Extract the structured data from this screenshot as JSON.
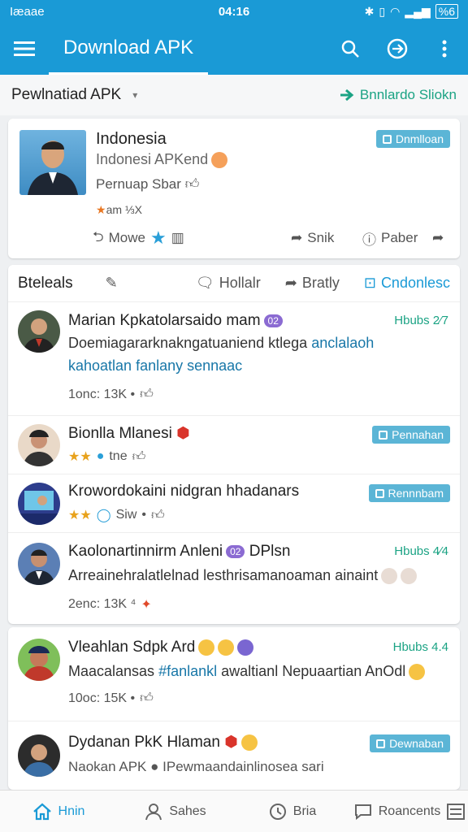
{
  "statusbar": {
    "carrier": "Iæaae",
    "time": "04:16",
    "battery": "%6"
  },
  "appbar": {
    "title": "Download APK"
  },
  "subhead": {
    "title": "Pewlnatiad APK",
    "link": "Bnnlardo Sliokn"
  },
  "card1": {
    "name": "Indonesia",
    "subtitle": "Indonesi APKend",
    "line3": "Pernuap Sbar",
    "line4": "am ⅓X",
    "badge": "Dnmlloan",
    "actions": {
      "more": "Mowe",
      "share": "Snik",
      "paber": "Paber"
    }
  },
  "card2": {
    "head": {
      "title": "Bteleals",
      "comment": "Hollalr",
      "reply": "Bratly",
      "download": "Cndonlesc"
    },
    "posts": [
      {
        "name": "Marian Kpkatolarsaido mam",
        "date": "Hbubs 2⁄7",
        "text1": "Doemiagararknakngatuaniend ktlega",
        "text1b": "anclalaoh",
        "text2": "kahoatlan fanlany sennaac",
        "meta": "1onc:  13K •"
      },
      {
        "name": "Bionlla Mlanesi",
        "badge": "Pennahan",
        "meta": "tne"
      },
      {
        "name": "Krowordokaini nidgran hhadanars",
        "badge": "Rennnbam",
        "meta": "Siw"
      },
      {
        "name": "Kaolonartinnirm Anleni",
        "tag": "DPlsn",
        "date": "Hbubs 4⁄4",
        "text1": "Arreainehralatlelnad lesthrisamanoaman ainaint",
        "meta": "2enc:  13K ⁴"
      }
    ]
  },
  "card3": {
    "posts": [
      {
        "name": "Vleahlan Sdpk Ard",
        "date": "Hbubs 4.4",
        "text1a": "Maacalansas",
        "text1b": "#fanlankl",
        "text1c": "awaltianl Nepuaartian AnOdl",
        "meta": "10oc:  15K •"
      },
      {
        "name": "Dydanan PkK Hlaman",
        "badge": "Dewnaban",
        "text1": "Naokan APK",
        "text1b": "IPewmaandainlinosea sari"
      }
    ]
  },
  "bottomnav": {
    "home": "Hnin",
    "search": "Sahes",
    "bria": "Bria",
    "recents": "Roancents"
  }
}
